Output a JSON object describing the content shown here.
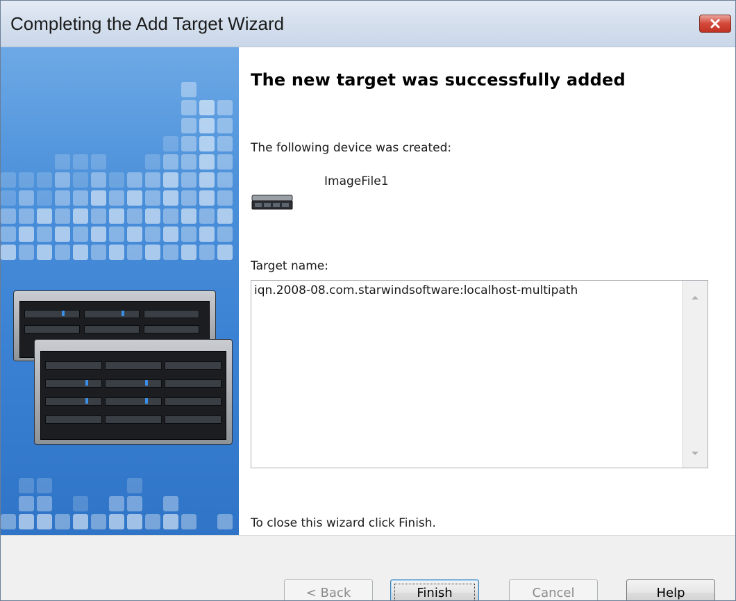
{
  "window": {
    "title": "Completing the Add Target Wizard"
  },
  "main": {
    "heading": "The new target was successfully added",
    "device_created_label": "The following device was created:",
    "device_name": "ImageFile1",
    "target_name_label": "Target name:",
    "target_name_value": "iqn.2008-08.com.starwindsoftware:localhost-multipath",
    "footer_instruction": "To close this wizard click Finish."
  },
  "buttons": {
    "back_label": "< Back",
    "finish_label": "Finish",
    "cancel_label": "Cancel",
    "help_label": "Help"
  },
  "icons": {
    "close": "close-icon",
    "device": "storage-device-icon",
    "banner": "server-rack-illustration"
  },
  "colors": {
    "title_bar": "#d6e0ee",
    "close_button": "#d4483a",
    "side_panel": "#3b82d4",
    "default_button_border": "#3c7fb1"
  }
}
